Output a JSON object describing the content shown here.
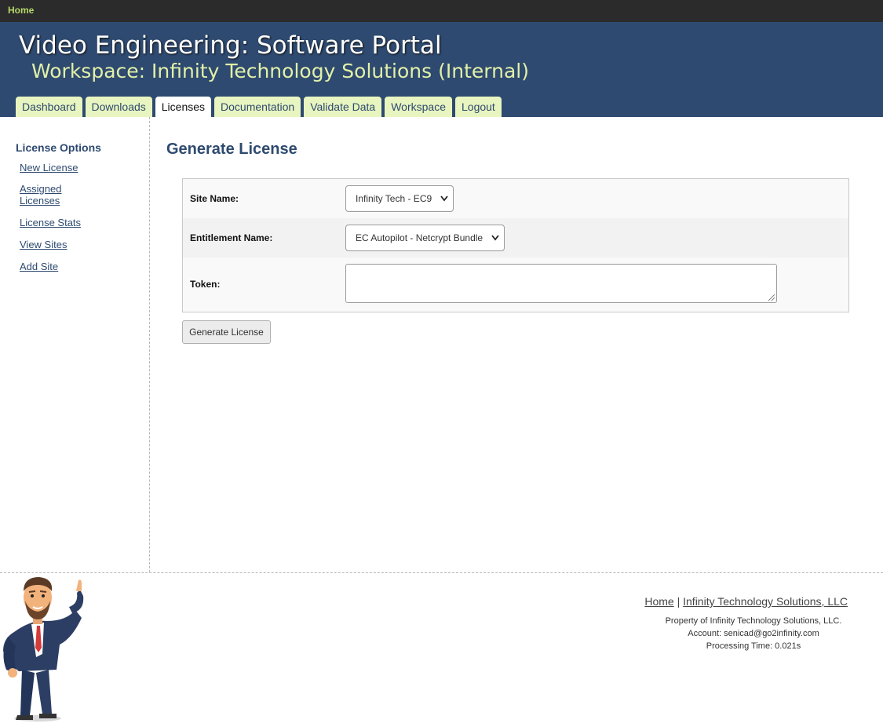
{
  "topbar": {
    "home_label": "Home"
  },
  "header": {
    "title": "Video Engineering: Software Portal",
    "subtitle": "Workspace: Infinity Technology Solutions (Internal)"
  },
  "tabs": [
    {
      "label": "Dashboard",
      "active": false
    },
    {
      "label": "Downloads",
      "active": false
    },
    {
      "label": "Licenses",
      "active": true
    },
    {
      "label": "Documentation",
      "active": false
    },
    {
      "label": "Validate Data",
      "active": false
    },
    {
      "label": "Workspace",
      "active": false
    },
    {
      "label": "Logout",
      "active": false
    }
  ],
  "sidebar": {
    "heading": "License Options",
    "items": [
      {
        "label": "New License"
      },
      {
        "label": "Assigned Licenses"
      },
      {
        "label": "License Stats"
      },
      {
        "label": "View Sites"
      },
      {
        "label": "Add Site"
      }
    ]
  },
  "main": {
    "heading": "Generate License",
    "form": {
      "site_label": "Site Name:",
      "site_value": "Infinity Tech - EC9",
      "entitlement_label": "Entitlement Name:",
      "entitlement_value": "EC Autopilot - Netcrypt Bundle",
      "token_label": "Token:",
      "token_value": ""
    },
    "submit_label": "Generate License"
  },
  "footer": {
    "home_link": "Home",
    "separator": "|",
    "company_link": "Infinity Technology Solutions, LLC",
    "property": "Property of Infinity Technology Solutions, LLC.",
    "account": "Account: senicad@go2infinity.com",
    "processing": "Processing Time: 0.021s"
  },
  "colors": {
    "topbar_bg": "#2b2b2b",
    "header_bg": "#2e4a70",
    "tab_bg": "#e8f5c0",
    "accent_text": "#2e4a70",
    "subtitle_text": "#e2f0a8"
  },
  "icons": {
    "dropdown": "chevron-down-icon",
    "mascot": "pointing-businessman-illustration"
  }
}
